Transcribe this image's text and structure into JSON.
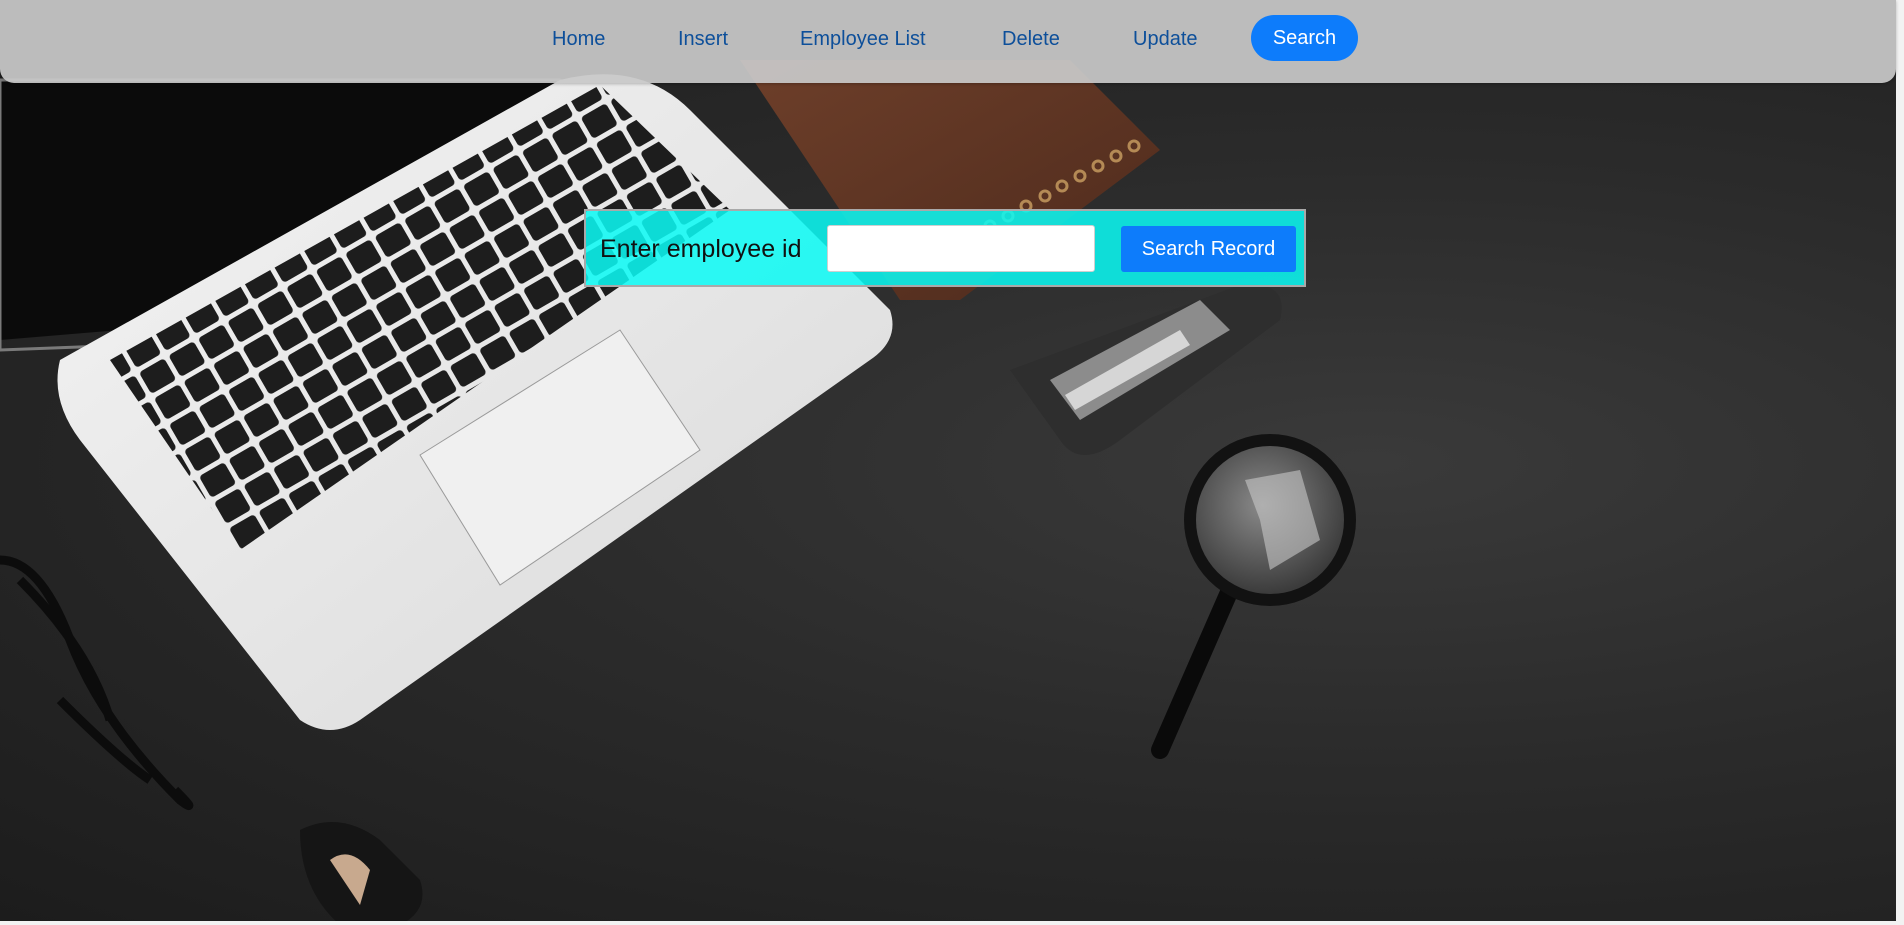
{
  "nav": {
    "home": "Home",
    "insert": "Insert",
    "employee_list": "Employee List",
    "delete": "Delete",
    "update": "Update",
    "search": "Search"
  },
  "search_form": {
    "label": "Enter employee id",
    "input_value": "",
    "button_label": "Search Record"
  },
  "colors": {
    "accent": "#0d7cfb",
    "nav_link": "#0d4f9a",
    "panel": "#0afaf5"
  },
  "background": {
    "icons": [
      "laptop-image",
      "notebook-image",
      "stapler-image",
      "magnifying-glass-image",
      "eyeglasses-image",
      "staple-remover-image"
    ]
  }
}
